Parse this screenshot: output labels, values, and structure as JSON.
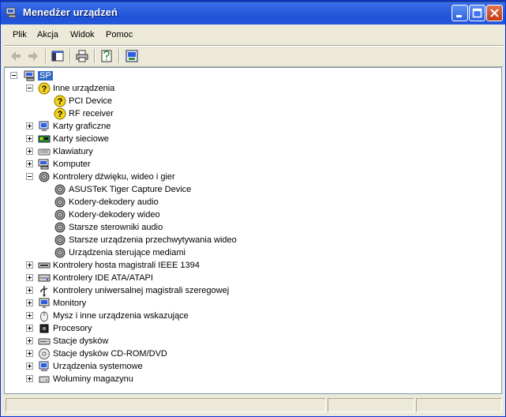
{
  "window": {
    "title": "Menedżer urządzeń"
  },
  "menu": {
    "items": [
      "Plik",
      "Akcja",
      "Widok",
      "Pomoc"
    ]
  },
  "toolbar": {
    "icons": [
      "back-arrow-icon",
      "forward-arrow-icon",
      "show-hide-console-tree-icon",
      "print-icon",
      "properties-icon",
      "update-driver-icon"
    ]
  },
  "tree": {
    "root": "SP",
    "nodes": [
      {
        "label": "Inne urządzenia",
        "icon": "unknown-device-icon",
        "level": 1,
        "expander": "minus"
      },
      {
        "label": "PCI Device",
        "icon": "unknown-device-icon",
        "level": 2
      },
      {
        "label": "RF receiver",
        "icon": "unknown-device-icon",
        "level": 2
      },
      {
        "label": "Karty graficzne",
        "icon": "display-adapter-icon",
        "level": 1,
        "expander": "plus"
      },
      {
        "label": "Karty sieciowe",
        "icon": "network-adapter-icon",
        "level": 1,
        "expander": "plus"
      },
      {
        "label": "Klawiatury",
        "icon": "keyboard-icon",
        "level": 1,
        "expander": "plus"
      },
      {
        "label": "Komputer",
        "icon": "computer-icon",
        "level": 1,
        "expander": "plus"
      },
      {
        "label": "Kontrolery dźwięku, wideo i gier",
        "icon": "speaker-icon",
        "level": 1,
        "expander": "minus"
      },
      {
        "label": "ASUSTeK Tiger Capture Device",
        "icon": "speaker-icon",
        "level": 2
      },
      {
        "label": "Kodery-dekodery audio",
        "icon": "speaker-icon",
        "level": 2
      },
      {
        "label": "Kodery-dekodery wideo",
        "icon": "speaker-icon",
        "level": 2
      },
      {
        "label": "Starsze sterowniki audio",
        "icon": "speaker-icon",
        "level": 2
      },
      {
        "label": "Starsze urządzenia przechwytywania wideo",
        "icon": "speaker-icon",
        "level": 2
      },
      {
        "label": "Urządzenia sterujące mediami",
        "icon": "speaker-icon",
        "level": 2
      },
      {
        "label": "Kontrolery hosta magistrali IEEE 1394",
        "icon": "ieee1394-icon",
        "level": 1,
        "expander": "plus"
      },
      {
        "label": "Kontrolery IDE ATA/ATAPI",
        "icon": "ide-controller-icon",
        "level": 1,
        "expander": "plus"
      },
      {
        "label": "Kontrolery uniwersalnej magistrali szeregowej",
        "icon": "usb-icon",
        "level": 1,
        "expander": "plus"
      },
      {
        "label": "Monitory",
        "icon": "monitor-icon",
        "level": 1,
        "expander": "plus"
      },
      {
        "label": "Mysz i inne urządzenia wskazujące",
        "icon": "mouse-icon",
        "level": 1,
        "expander": "plus"
      },
      {
        "label": "Procesory",
        "icon": "processor-icon",
        "level": 1,
        "expander": "plus"
      },
      {
        "label": "Stacje dysków",
        "icon": "disk-drive-icon",
        "level": 1,
        "expander": "plus"
      },
      {
        "label": "Stacje dysków CD-ROM/DVD",
        "icon": "cdrom-icon",
        "level": 1,
        "expander": "plus"
      },
      {
        "label": "Urządzenia systemowe",
        "icon": "system-device-icon",
        "level": 1,
        "expander": "plus"
      },
      {
        "label": "Woluminy magazynu",
        "icon": "storage-volume-icon",
        "level": 1,
        "expander": "plus"
      }
    ]
  },
  "colors": {
    "titlebar": "#2b5fe0",
    "selection": "#316ac5",
    "face": "#ece9d8"
  }
}
